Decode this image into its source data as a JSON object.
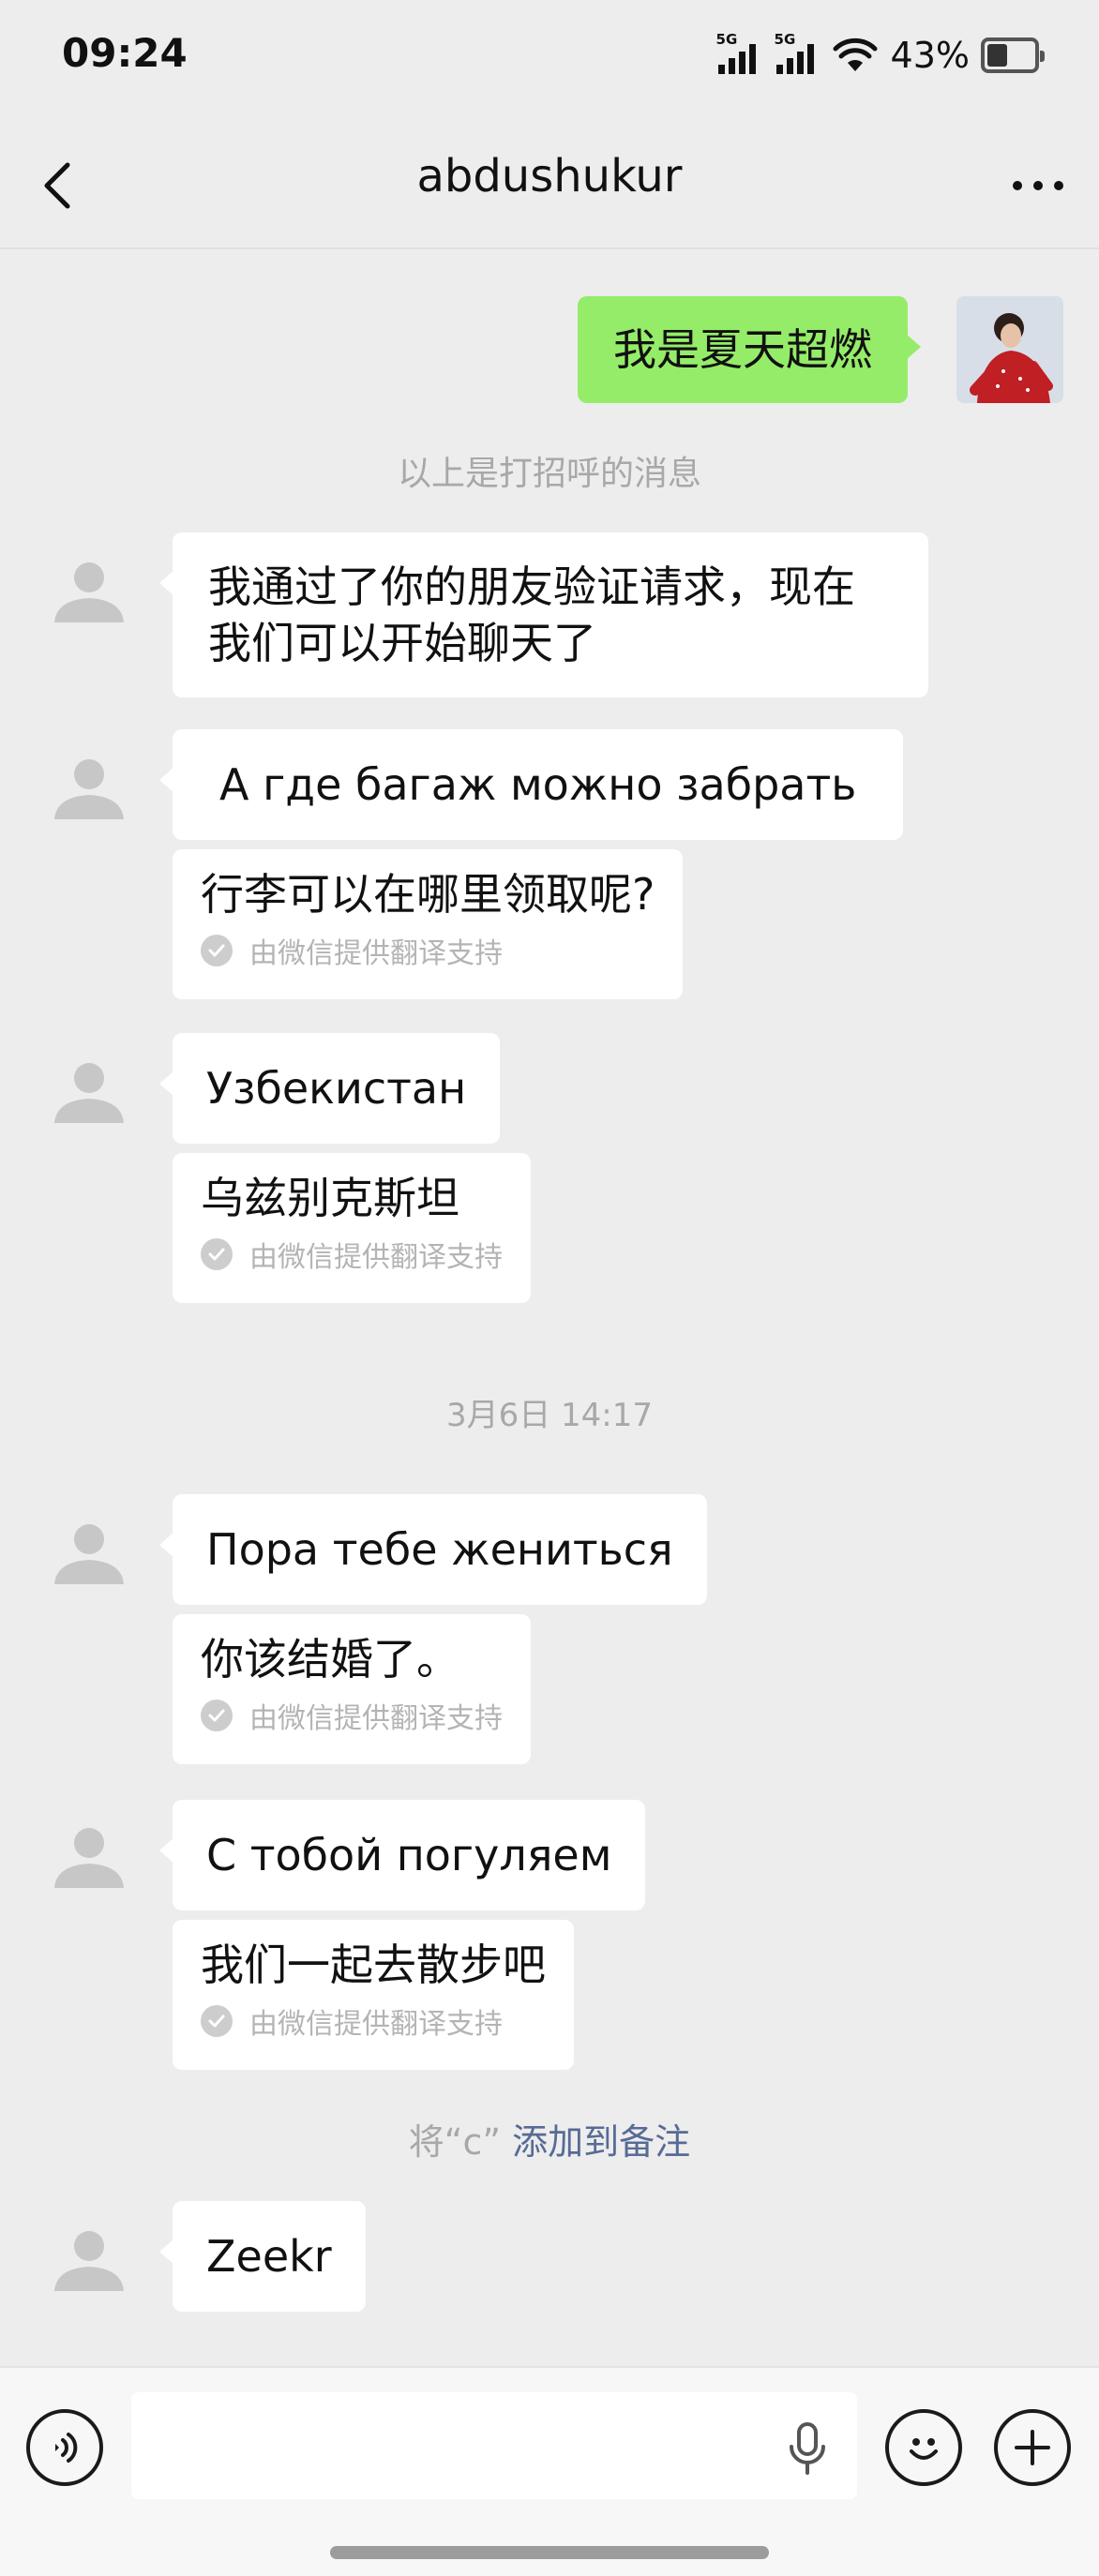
{
  "status_bar": {
    "time": "09:24",
    "signal_1_label": "5G",
    "signal_2_label": "5G",
    "battery_percent_text": "43%",
    "battery_level": 0.43
  },
  "header": {
    "title": "abdushukur",
    "back_icon": "chevron-left-icon",
    "more_icon": "more-horizontal-icon"
  },
  "chat": {
    "outgoing_greeting": "我是夏天超燃",
    "greeting_notice": "以上是打招呼的消息",
    "accepted_message": "我通过了你的朋友验证请求，现在我们可以开始聊天了",
    "messages": [
      {
        "text": "А где багаж можно забрать",
        "translation": "行李可以在哪里领取呢?"
      },
      {
        "text": "Узбекистан",
        "translation": "乌兹别克斯坦"
      },
      {
        "text": "Пора тебе жениться",
        "translation": "你该结婚了。"
      },
      {
        "text": "С тобой погуляем",
        "translation": "我们一起去散步吧"
      }
    ],
    "translation_source": "由微信提供翻译支持",
    "timestamp": "3月6日 14:17",
    "remark_prefix": "将“c”",
    "remark_link": "添加到备注",
    "last_message": "Zeekr"
  },
  "input_bar": {
    "voice_icon": "voice-mode-icon",
    "mic_icon": "microphone-icon",
    "emoji_icon": "emoji-icon",
    "plus_icon": "plus-icon",
    "input_value": ""
  },
  "colors": {
    "background": "#ededed",
    "outgoing_bubble": "#95ec69",
    "incoming_bubble": "#ffffff",
    "link": "#576b95",
    "meta_text": "#a8a8a8"
  }
}
